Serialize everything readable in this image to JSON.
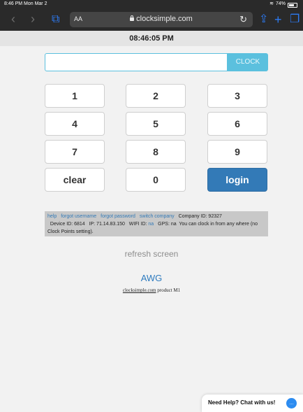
{
  "statusbar": {
    "time": "8:46 PM  Mon Mar 2",
    "battery": "74%"
  },
  "browser": {
    "back": "‹",
    "forward": "›",
    "book": "⧉",
    "aa": "AA",
    "url": "clocksimple.com",
    "reload": "↻",
    "share": "⇪",
    "plus": "+",
    "tabs": "❐"
  },
  "header": {
    "time": "08:46:05 PM"
  },
  "clock": {
    "input_value": "",
    "placeholder": "",
    "button": "CLOCK"
  },
  "keypad": {
    "keys": [
      "1",
      "2",
      "3",
      "4",
      "5",
      "6",
      "7",
      "8",
      "9",
      "clear",
      "0",
      "login"
    ]
  },
  "info": {
    "links": [
      "help",
      "forgot username",
      "forgot password",
      "switch company"
    ],
    "company_id": "Company ID: 92327",
    "device_id": "Device ID: 6814",
    "ip": "IP: 71.14.83.150",
    "wifi_label": "WIFI ID:",
    "wifi_value": "na",
    "gps": "GPS: na",
    "message": "You can clock in from any where (no Clock Points setting)."
  },
  "footer": {
    "refresh": "refresh screen",
    "company": "AWG",
    "product_link": "clocksimple.com",
    "product_text": " product M1"
  },
  "chat": {
    "label": "Need Help? Chat with us!",
    "icon": "…"
  }
}
